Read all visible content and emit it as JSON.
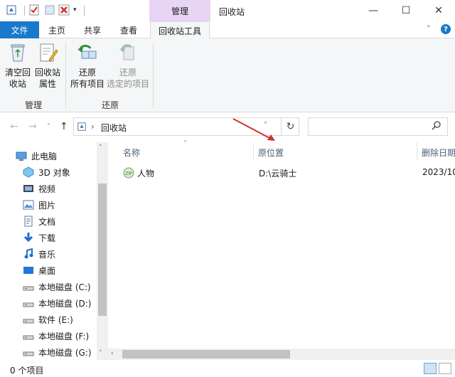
{
  "window": {
    "title": "回收站",
    "context_group": "管理",
    "minimize": "—",
    "maximize": "☐",
    "close": "✕"
  },
  "ribbon": {
    "tabs": [
      "文件",
      "主页",
      "共享",
      "查看"
    ],
    "active_tab": "回收站工具",
    "collapse_glyph": "˄",
    "help_glyph": "?",
    "groups": [
      {
        "label": "管理",
        "buttons": [
          {
            "label": "清空回\n收站",
            "icon": "recycle-bin-empty-icon"
          },
          {
            "label": "回收站\n属性",
            "icon": "properties-icon"
          }
        ]
      },
      {
        "label": "还原",
        "buttons": [
          {
            "label": "还原\n所有项目",
            "icon": "restore-all-icon"
          },
          {
            "label": "还原\n选定的项目",
            "icon": "restore-selected-icon",
            "disabled": true
          }
        ]
      }
    ]
  },
  "address": {
    "back": "←",
    "forward": "→",
    "recent": "˅",
    "up": "↑",
    "crumb_sep": "›",
    "path": "回收站",
    "dropdown": "˅",
    "refresh": "↻",
    "search_placeholder": ""
  },
  "nav": {
    "items": [
      {
        "label": "此电脑",
        "icon": "this-pc-icon"
      },
      {
        "label": "3D 对象",
        "icon": "3d-objects-icon"
      },
      {
        "label": "视频",
        "icon": "videos-icon"
      },
      {
        "label": "图片",
        "icon": "pictures-icon"
      },
      {
        "label": "文档",
        "icon": "documents-icon"
      },
      {
        "label": "下载",
        "icon": "downloads-icon"
      },
      {
        "label": "音乐",
        "icon": "music-icon"
      },
      {
        "label": "桌面",
        "icon": "desktop-icon"
      },
      {
        "label": "本地磁盘 (C:)",
        "icon": "drive-icon"
      },
      {
        "label": "本地磁盘 (D:)",
        "icon": "drive-icon"
      },
      {
        "label": "软件 (E:)",
        "icon": "drive-icon"
      },
      {
        "label": "本地磁盘 (F:)",
        "icon": "drive-icon"
      },
      {
        "label": "本地磁盘 (G:)",
        "icon": "drive-icon"
      }
    ]
  },
  "table": {
    "columns": [
      "名称",
      "原位置",
      "删除日期"
    ],
    "rows": [
      {
        "name": "人物",
        "location": "D:\\云骑士",
        "date": "2023/10"
      }
    ]
  },
  "status": {
    "text": "0 个项目"
  },
  "colors": {
    "accent": "#1979ca",
    "context_tab": "#e8d4f5",
    "annotation_arrow": "#d0312d"
  }
}
